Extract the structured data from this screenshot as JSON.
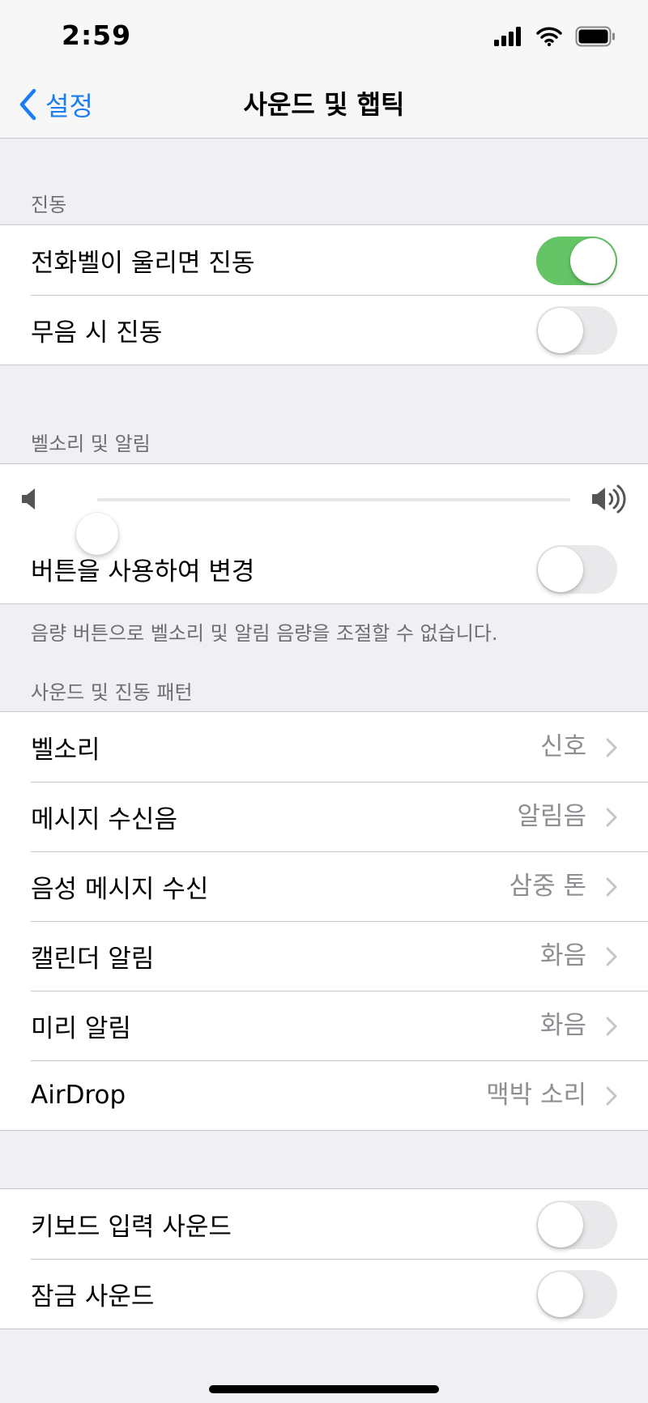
{
  "status_bar": {
    "time": "2:59"
  },
  "nav": {
    "back_label": "설정",
    "title": "사운드 및 햅틱"
  },
  "vibration": {
    "header": "진동",
    "items": [
      {
        "label": "전화벨이 울리면 진동",
        "on": true
      },
      {
        "label": "무음 시 진동",
        "on": false
      }
    ]
  },
  "ringer": {
    "header": "벨소리 및 알림",
    "volume_level": 0.0,
    "change_with_buttons": {
      "label": "버튼을 사용하여 변경",
      "on": false
    },
    "footer": "음량 버튼으로 벨소리 및 알림 음량을 조절할 수 없습니다."
  },
  "patterns": {
    "header": "사운드 및 진동 패턴",
    "items": [
      {
        "label": "벨소리",
        "value": "신호"
      },
      {
        "label": "메시지 수신음",
        "value": "알림음"
      },
      {
        "label": "음성 메시지 수신",
        "value": "삼중 톤"
      },
      {
        "label": "캘린더 알림",
        "value": "화음"
      },
      {
        "label": "미리 알림",
        "value": "화음"
      },
      {
        "label": "AirDrop",
        "value": "맥박 소리"
      }
    ]
  },
  "system_sounds": {
    "items": [
      {
        "label": "키보드 입력 사운드",
        "on": false
      },
      {
        "label": "잠금 사운드",
        "on": false
      }
    ]
  },
  "colors": {
    "accent": "#1a7ef2",
    "toggle_on": "#65c466",
    "toggle_off": "#e9e9eb",
    "background": "#efeff4"
  },
  "icons": [
    "signal-icon",
    "wifi-icon",
    "battery-icon",
    "back-chevron-icon",
    "speaker-low-icon",
    "speaker-high-icon",
    "chevron-right-icon"
  ]
}
